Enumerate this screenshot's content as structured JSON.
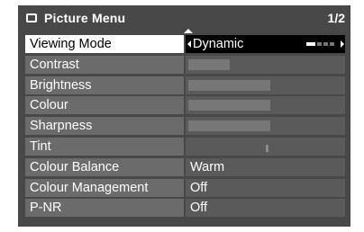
{
  "header": {
    "title": "Picture Menu",
    "page": "1/2",
    "icon": "menu-screen-icon"
  },
  "rows": [
    {
      "key": "viewing_mode",
      "label": "Viewing Mode",
      "value": "Dynamic",
      "type": "selector",
      "selected": true,
      "option_index": 1,
      "option_count": 4
    },
    {
      "key": "contrast",
      "label": "Contrast",
      "type": "bar",
      "level": 0.27
    },
    {
      "key": "brightness",
      "label": "Brightness",
      "type": "bar",
      "level": 0.53
    },
    {
      "key": "colour",
      "label": "Colour",
      "type": "bar",
      "level": 0.53
    },
    {
      "key": "sharpness",
      "label": "Sharpness",
      "type": "bar",
      "level": 0.53
    },
    {
      "key": "tint",
      "label": "Tint",
      "type": "center",
      "level": 0.5
    },
    {
      "key": "colour_balance",
      "label": "Colour Balance",
      "value": "Warm",
      "type": "text"
    },
    {
      "key": "colour_management",
      "label": "Colour Management",
      "value": "Off",
      "type": "text"
    },
    {
      "key": "p_nr",
      "label": "P-NR",
      "value": "Off",
      "type": "text"
    }
  ],
  "colors": {
    "panel": "#484848",
    "label_bg": "#6b6b6b",
    "value_bg": "#5a5a5a",
    "selected_label_bg": "#ffffff",
    "selected_value_bg": "#000000"
  }
}
